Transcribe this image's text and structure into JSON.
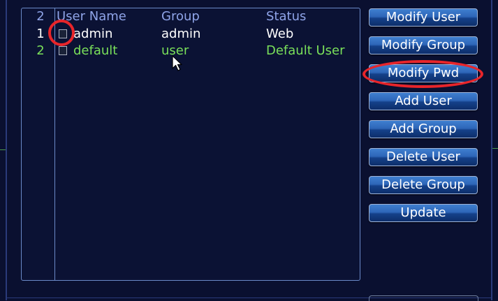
{
  "user_table": {
    "headers": {
      "index": "2",
      "user_name": "User Name",
      "group": "Group",
      "status": "Status"
    },
    "rows": [
      {
        "index": "1",
        "user_name": "admin",
        "group": "admin",
        "status": "Web"
      },
      {
        "index": "2",
        "user_name": "default",
        "group": "user",
        "status": "Default User"
      }
    ]
  },
  "buttons": {
    "modify_user": "Modify User",
    "modify_group": "Modify Group",
    "modify_pwd": "Modify Pwd",
    "add_user": "Add User",
    "add_group": "Add Group",
    "delete_user": "Delete User",
    "delete_group": "Delete Group",
    "update": "Update"
  },
  "colors": {
    "background": "#0a1030",
    "header_text": "#8fa4e8",
    "admin_row_text": "#ffffff",
    "default_row_text": "#7ae05a",
    "annotation_red": "#e8252a",
    "button_blue": "#2e66b8"
  }
}
